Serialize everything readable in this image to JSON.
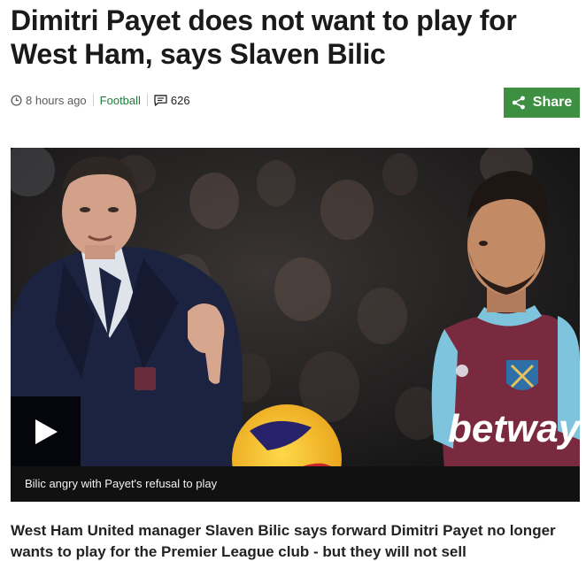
{
  "article": {
    "headline": "Dimitri Payet does not want to play for West Ham, says Slaven Bilic",
    "meta": {
      "timestamp": "8 hours ago",
      "topic": "Football",
      "comment_count": "626"
    },
    "share_label": "Share",
    "media": {
      "caption": "Bilic angry with Payet's refusal to play",
      "shirt_sponsor_text": "betway"
    },
    "intro": "West Ham United manager Slaven Bilic says forward Dimitri Payet no longer wants to play for the Premier League club - but they will not sell"
  },
  "icons": {
    "timestamp": "clock-icon",
    "comments": "comments-icon",
    "share": "share-icon",
    "play": "play-icon"
  },
  "colors": {
    "topic_link": "#1f7a3b",
    "share_button": "#3d8f41",
    "caption_bar": "#111111",
    "claret": "#7a2a3f",
    "sky_blue": "#7fc4dd"
  }
}
